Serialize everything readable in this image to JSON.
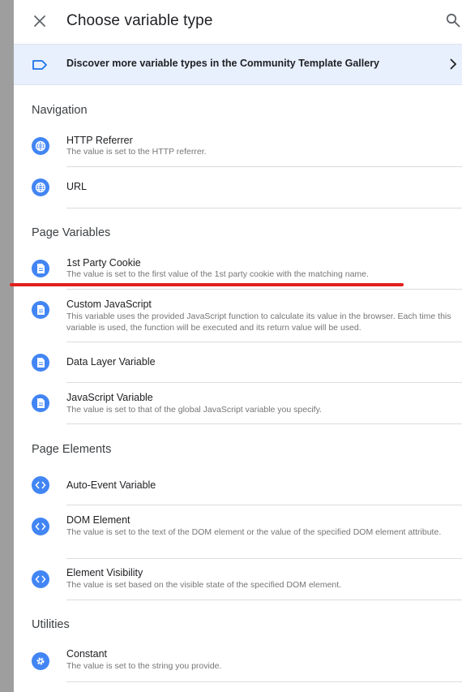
{
  "header": {
    "title": "Choose variable type",
    "close_icon": "close-icon",
    "search_icon": "search-icon"
  },
  "banner": {
    "text": "Discover more variable types in the Community Template Gallery",
    "icon": "label-tag-icon"
  },
  "colors": {
    "accent": "#4285f4",
    "banner_bg": "#e8f0fe",
    "annotation_red": "#e0201c"
  },
  "sections": [
    {
      "heading": "Navigation",
      "items": [
        {
          "title": "HTTP Referrer",
          "desc": "The value is set to the HTTP referrer.",
          "icon": "globe-icon"
        },
        {
          "title": "URL",
          "desc": "",
          "icon": "globe-icon"
        }
      ]
    },
    {
      "heading": "Page Variables",
      "items": [
        {
          "title": "1st Party Cookie",
          "desc": "The value is set to the first value of the 1st party cookie with the matching name.",
          "icon": "document-icon"
        },
        {
          "title": "Custom JavaScript",
          "desc": "This variable uses the provided JavaScript function to calculate its value in the browser. Each time this variable is used, the function will be executed and its return value will be used.",
          "icon": "document-icon"
        },
        {
          "title": "Data Layer Variable",
          "desc": "",
          "icon": "document-icon"
        },
        {
          "title": "JavaScript Variable",
          "desc": "The value is set to that of the global JavaScript variable you specify.",
          "icon": "document-icon"
        }
      ]
    },
    {
      "heading": "Page Elements",
      "items": [
        {
          "title": "Auto-Event Variable",
          "desc": "",
          "icon": "code-icon"
        },
        {
          "title": "DOM Element",
          "desc": "The value is set to the text of the DOM element or the value of the specified DOM element attribute.",
          "icon": "code-icon"
        },
        {
          "title": "Element Visibility",
          "desc": "The value is set based on the visible state of the specified DOM element.",
          "icon": "code-icon"
        }
      ]
    },
    {
      "heading": "Utilities",
      "items": [
        {
          "title": "Constant",
          "desc": "The value is set to the string you provide.",
          "icon": "gear-icon"
        }
      ]
    }
  ]
}
